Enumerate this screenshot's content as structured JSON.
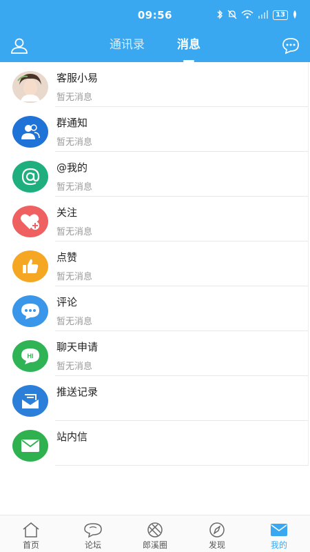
{
  "status_bar": {
    "time": "09:56",
    "battery": "13"
  },
  "header": {
    "tabs": [
      {
        "label": "通讯录",
        "active": false
      },
      {
        "label": "消息",
        "active": true
      }
    ],
    "user_icon": "user-icon",
    "chat_icon": "chat-bubble-icon"
  },
  "messages": [
    {
      "title": "客服小易",
      "subtitle": "暂无消息",
      "icon": "customer-service-avatar",
      "color": "#f2e6dd"
    },
    {
      "title": "群通知",
      "subtitle": "暂无消息",
      "icon": "group-icon",
      "color": "#1f73d6"
    },
    {
      "title": "@我的",
      "subtitle": "暂无消息",
      "icon": "at-icon",
      "color": "#1fae7e"
    },
    {
      "title": "关注",
      "subtitle": "暂无消息",
      "icon": "heart-plus-icon",
      "color": "#ef6061"
    },
    {
      "title": "点赞",
      "subtitle": "暂无消息",
      "icon": "thumbs-up-icon",
      "color": "#f5a623"
    },
    {
      "title": "评论",
      "subtitle": "暂无消息",
      "icon": "comment-icon",
      "color": "#3a96e8"
    },
    {
      "title": "聊天申请",
      "subtitle": "暂无消息",
      "icon": "hi-chat-icon",
      "color": "#2fb355"
    },
    {
      "title": "推送记录",
      "subtitle": "",
      "icon": "inbox-icon",
      "color": "#2b7fd8"
    },
    {
      "title": "站内信",
      "subtitle": "",
      "icon": "envelope-icon",
      "color": "#30b14f"
    }
  ],
  "bottom_nav": [
    {
      "label": "首页",
      "icon": "home-icon",
      "active": false
    },
    {
      "label": "论坛",
      "icon": "forum-icon",
      "active": false
    },
    {
      "label": "郎溪圈",
      "icon": "circle-icon",
      "active": false
    },
    {
      "label": "发现",
      "icon": "compass-icon",
      "active": false
    },
    {
      "label": "我的",
      "icon": "mail-icon",
      "active": true
    }
  ],
  "colors": {
    "primary": "#3aa8f0",
    "active_tab": "#3aa8f0"
  }
}
